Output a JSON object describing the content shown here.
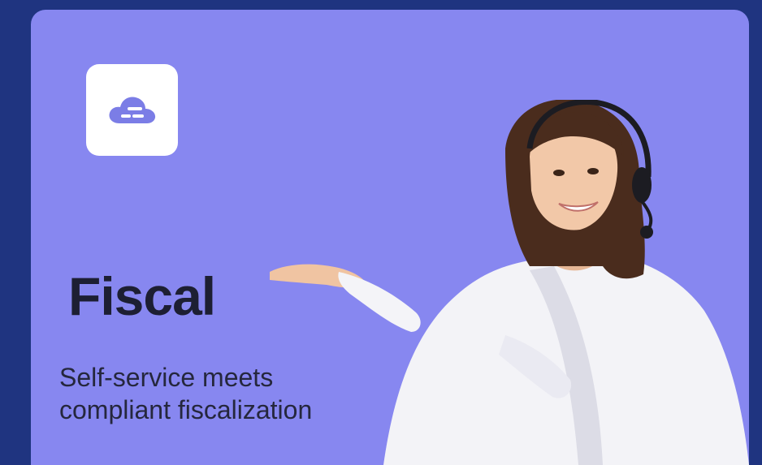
{
  "card": {
    "icon": "cloud-icon",
    "title": "Fiscal",
    "subtitle_line1": "Self-service meets",
    "subtitle_line2": "compliant fiscalization",
    "photo": "support-agent-with-headset"
  },
  "colors": {
    "page_background": "#1f3480",
    "card_background": "#8787f0",
    "icon_tile": "#ffffff",
    "icon_color": "#7b7de6",
    "title_color": "#1d1f33"
  }
}
